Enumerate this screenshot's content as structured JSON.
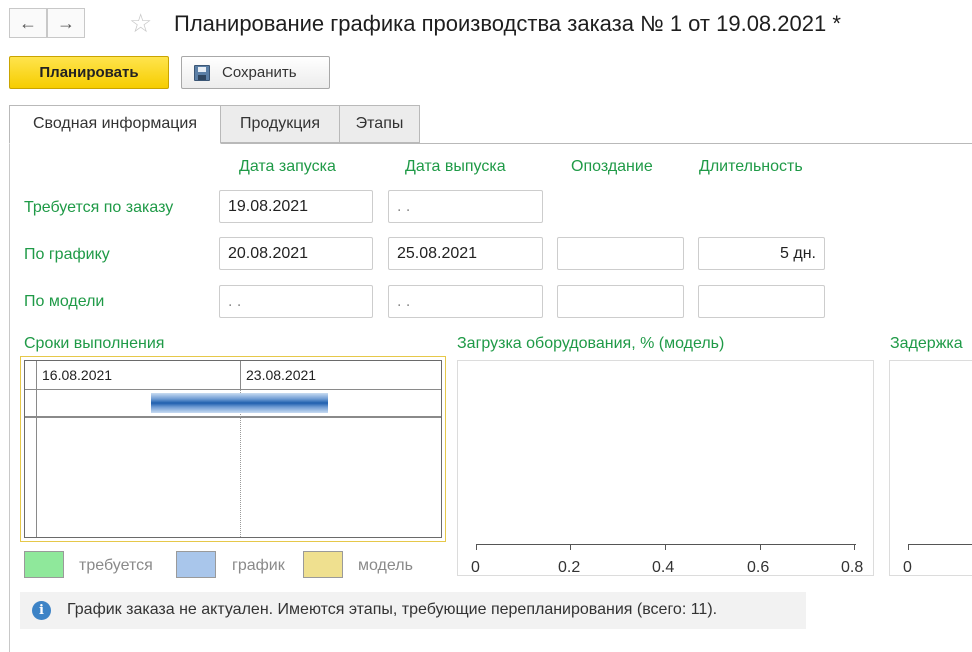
{
  "window": {
    "title": "Планирование графика производства заказа № 1 от 19.08.2021 *",
    "back_icon": "←",
    "forward_icon": "→",
    "favorite_icon": "☆"
  },
  "toolbar": {
    "plan_label": "Планировать",
    "save_label": "Сохранить"
  },
  "tabs": [
    {
      "label": "Сводная информация",
      "active": true
    },
    {
      "label": "Продукция",
      "active": false
    },
    {
      "label": "Этапы",
      "active": false
    }
  ],
  "summary": {
    "columns": {
      "start": "Дата запуска",
      "release": "Дата выпуска",
      "delay": "Опоздание",
      "duration": "Длительность"
    },
    "rows": {
      "required": {
        "label": "Требуется по заказу",
        "start": "19.08.2021",
        "release": " .  ."
      },
      "schedule": {
        "label": "По графику",
        "start": "20.08.2021",
        "release": "25.08.2021",
        "delay": "",
        "duration": "5 дн."
      },
      "model": {
        "label": "По модели",
        "start": " .  .",
        "release": " .  .",
        "delay": "",
        "duration": ""
      }
    }
  },
  "timeline": {
    "title": "Сроки выполнения",
    "dates": [
      "16.08.2021",
      "23.08.2021"
    ],
    "legend": [
      {
        "label": "требуется",
        "color": "#8fe89b"
      },
      {
        "label": "график",
        "color": "#a9c6eb"
      },
      {
        "label": "модель",
        "color": "#efe08f"
      }
    ]
  },
  "equipment_chart": {
    "title": "Загрузка оборудования, % (модель)",
    "ticks": [
      "0",
      "0.2",
      "0.4",
      "0.6",
      "0.8"
    ]
  },
  "delay_chart": {
    "title": "Задержка",
    "ticks": [
      "0"
    ]
  },
  "info": {
    "icon": "i",
    "message": "График заказа не актуален. Имеются этапы, требующие перепланирования (всего: 11)."
  }
}
